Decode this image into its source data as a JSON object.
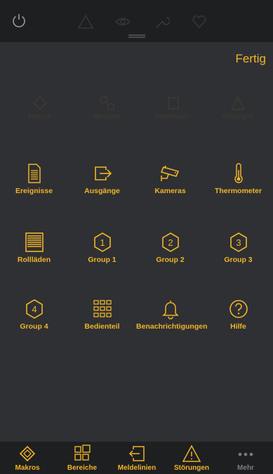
{
  "header": {
    "done_label": "Fertig"
  },
  "faded_row": [
    "Makros",
    "Bereiche",
    "Meldelinien",
    "Störungen"
  ],
  "grid": [
    {
      "label": "Ereignisse",
      "icon": "document-icon"
    },
    {
      "label": "Ausgänge",
      "icon": "exit-arrow-icon"
    },
    {
      "label": "Kameras",
      "icon": "camera-icon"
    },
    {
      "label": "Thermometer",
      "icon": "thermometer-icon"
    },
    {
      "label": "Rollläden",
      "icon": "shutter-icon"
    },
    {
      "label": "Group 1",
      "icon": "hexagon-1-icon"
    },
    {
      "label": "Group 2",
      "icon": "hexagon-2-icon"
    },
    {
      "label": "Group 3",
      "icon": "hexagon-3-icon"
    },
    {
      "label": "Group 4",
      "icon": "hexagon-4-icon"
    },
    {
      "label": "Bedienteil",
      "icon": "keypad-icon"
    },
    {
      "label": "Benachrichtigungen",
      "icon": "bell-icon"
    },
    {
      "label": "Hilfe",
      "icon": "help-icon"
    }
  ],
  "hex_numbers": [
    "1",
    "2",
    "3",
    "4"
  ],
  "tabbar": [
    {
      "label": "Makros",
      "icon": "macro-diamond-icon"
    },
    {
      "label": "Bereiche",
      "icon": "areas-grid-icon"
    },
    {
      "label": "Meldelinien",
      "icon": "zone-entry-icon"
    },
    {
      "label": "Störungen",
      "icon": "warning-icon"
    },
    {
      "label": "Mehr",
      "icon": "more-dots-icon"
    }
  ],
  "colors": {
    "accent": "#f0b429",
    "background": "#2f3033",
    "bar": "#1e1f21",
    "inactive": "#7b7c80"
  }
}
